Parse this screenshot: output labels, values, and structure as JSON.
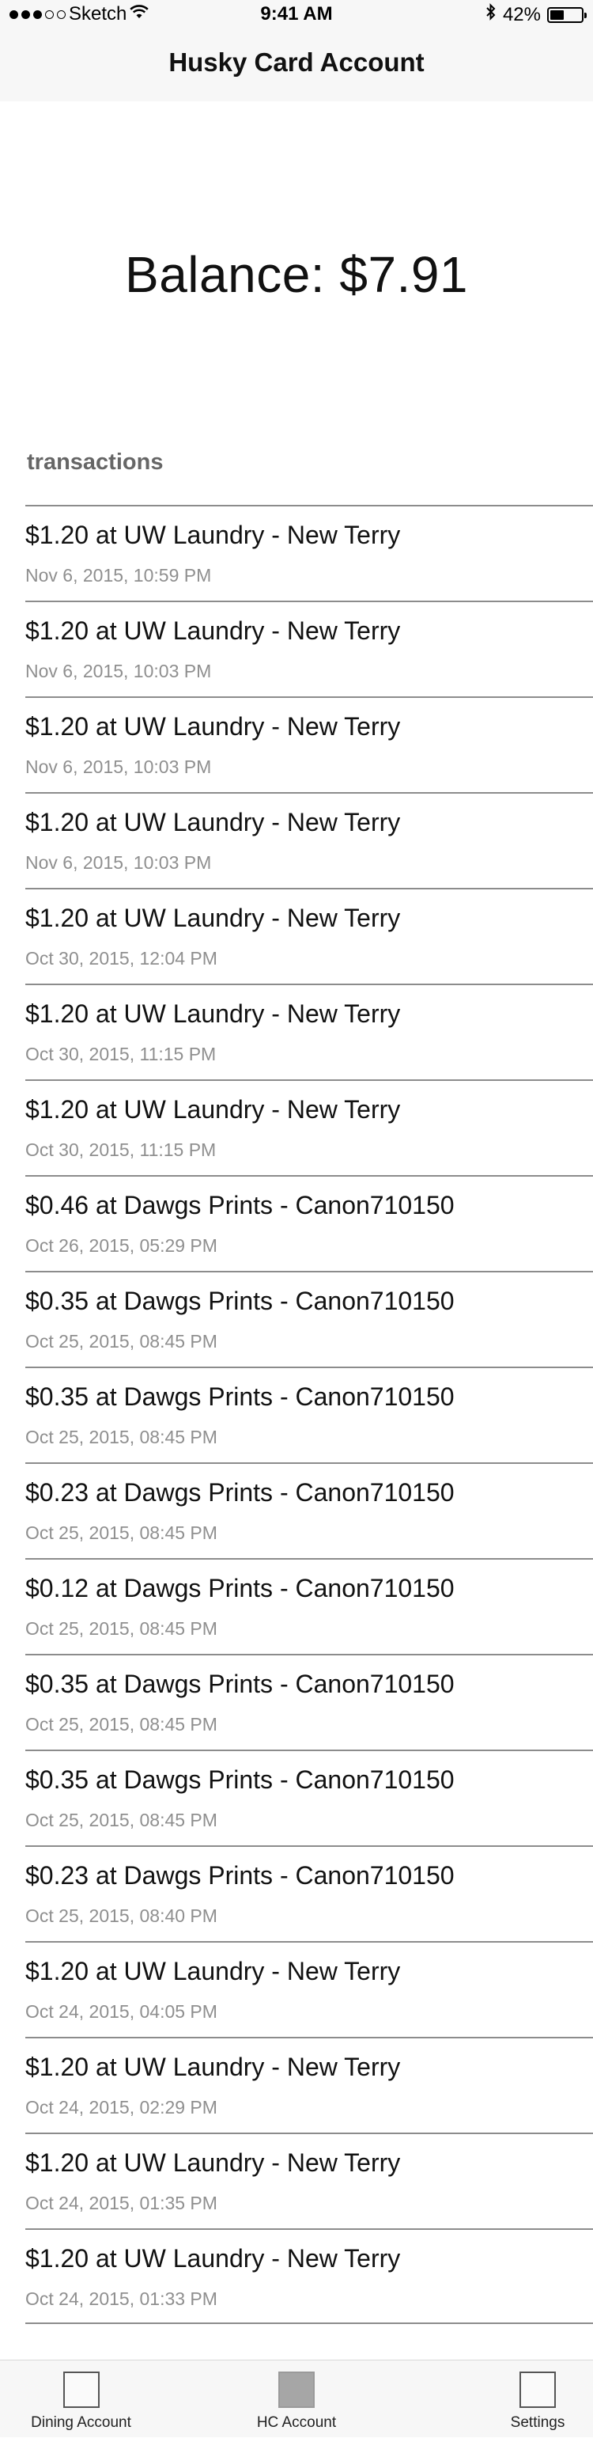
{
  "status_bar": {
    "carrier": "Sketch",
    "time": "9:41 AM",
    "battery_percent": "42%",
    "icons": [
      "signal-dots-icon",
      "wifi-icon",
      "bluetooth-icon",
      "battery-icon"
    ]
  },
  "header": {
    "title": "Husky Card Account"
  },
  "balance": {
    "text": "Balance: $7.91"
  },
  "section": {
    "title": "transactions"
  },
  "transactions": [
    {
      "title": "$1.20 at UW Laundry - New Terry",
      "date": "Nov 6, 2015, 10:59 PM"
    },
    {
      "title": "$1.20 at UW Laundry - New Terry",
      "date": "Nov 6, 2015, 10:03 PM"
    },
    {
      "title": "$1.20 at UW Laundry - New Terry",
      "date": "Nov 6, 2015, 10:03 PM"
    },
    {
      "title": "$1.20 at UW Laundry - New Terry",
      "date": "Nov 6, 2015, 10:03 PM"
    },
    {
      "title": "$1.20 at UW Laundry - New Terry",
      "date": "Oct 30, 2015, 12:04 PM"
    },
    {
      "title": "$1.20 at UW Laundry - New Terry",
      "date": "Oct 30, 2015, 11:15 PM"
    },
    {
      "title": "$1.20 at UW Laundry - New Terry",
      "date": "Oct 30, 2015, 11:15 PM"
    },
    {
      "title": "$0.46 at Dawgs Prints - Canon710150",
      "date": "Oct 26, 2015, 05:29 PM"
    },
    {
      "title": "$0.35 at Dawgs Prints - Canon710150",
      "date": "Oct 25, 2015, 08:45 PM"
    },
    {
      "title": "$0.35 at Dawgs Prints - Canon710150",
      "date": "Oct 25, 2015, 08:45 PM"
    },
    {
      "title": "$0.23 at Dawgs Prints - Canon710150",
      "date": "Oct 25, 2015, 08:45 PM"
    },
    {
      "title": "$0.12 at Dawgs Prints - Canon710150",
      "date": "Oct 25, 2015, 08:45 PM"
    },
    {
      "title": "$0.35 at Dawgs Prints - Canon710150",
      "date": "Oct 25, 2015, 08:45 PM"
    },
    {
      "title": "$0.35 at Dawgs Prints - Canon710150",
      "date": "Oct 25, 2015, 08:45 PM"
    },
    {
      "title": "$0.23 at Dawgs Prints - Canon710150",
      "date": "Oct 25, 2015, 08:40 PM"
    },
    {
      "title": "$1.20 at UW Laundry - New Terry",
      "date": "Oct 24, 2015, 04:05 PM"
    },
    {
      "title": "$1.20 at UW Laundry - New Terry",
      "date": "Oct 24, 2015, 02:29 PM"
    },
    {
      "title": "$1.20 at UW Laundry - New Terry",
      "date": "Oct 24, 2015, 01:35 PM"
    },
    {
      "title": "$1.20 at UW Laundry - New Terry",
      "date": "Oct 24, 2015, 01:33 PM"
    }
  ],
  "tabbar": {
    "tabs": [
      {
        "label": "Dining Account",
        "icon": "tab-placeholder-icon",
        "selected": false
      },
      {
        "label": "HC Account",
        "icon": "tab-placeholder-icon",
        "selected": true
      },
      {
        "label": "Settings",
        "icon": "tab-placeholder-icon",
        "selected": false
      }
    ]
  },
  "colors": {
    "header_bg": "#f7f7f7",
    "separator": "#8c8c8c",
    "secondary_text": "#8f8f8f",
    "section_header_text": "#666666",
    "selected_tab_fill": "#a6a6a6"
  }
}
